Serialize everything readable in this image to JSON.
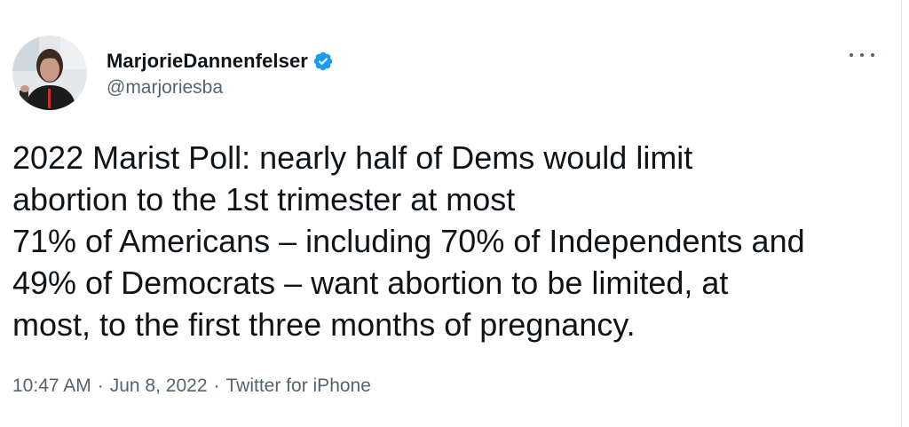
{
  "tweet": {
    "author": {
      "display_name": "MarjorieDannenfelser",
      "handle": "@marjoriesba",
      "verified": true,
      "verified_icon": "verified-badge-icon",
      "avatar_icon": "avatar-photo"
    },
    "more_icon": "more-options-icon",
    "text_lines": [
      "2022 Marist Poll:  nearly half of Dems would limit",
      "abortion to the 1st trimester at most",
      "71% of Americans – including 70% of Independents and",
      "49% of Democrats – want abortion to be limited, at",
      "most, to the first three months of pregnancy."
    ],
    "meta": {
      "time": "10:47 AM",
      "date": "Jun 8, 2022",
      "source": "Twitter for iPhone",
      "separator": "·"
    }
  },
  "colors": {
    "text_primary": "#0f1419",
    "text_secondary": "#536471",
    "verified_blue": "#1d9bf0",
    "background": "#ffffff"
  }
}
